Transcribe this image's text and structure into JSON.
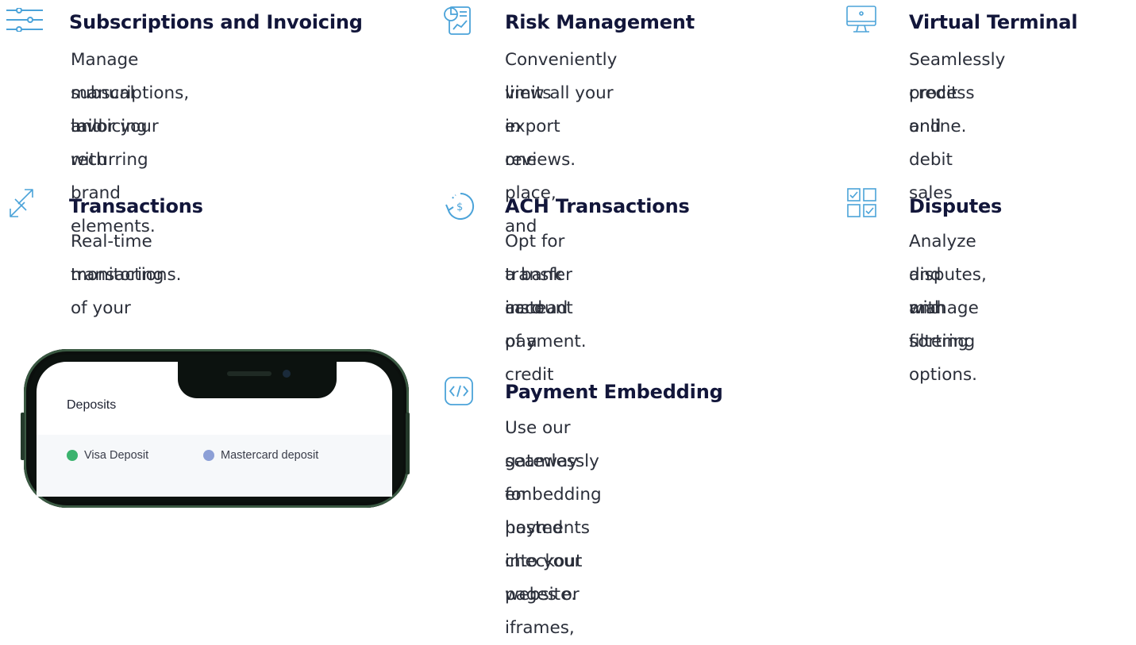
{
  "features": [
    {
      "icon": "sliders-icon",
      "title": "Subscriptions and Invoicing",
      "desc": [
        "Manage manual and recurring",
        "subscriptions, tailor your",
        "invoicing with brand elements."
      ]
    },
    {
      "icon": "report-chart-icon",
      "title": "Risk Management",
      "desc": [
        "Conveniently view all your",
        "limits in one place, and",
        "export reviews."
      ]
    },
    {
      "icon": "monitor-icon",
      "title": "Virtual Terminal",
      "desc": [
        "Seamlessly process",
        "credit and debit sales",
        "online."
      ]
    },
    {
      "icon": "transfer-arrows-icon",
      "title": "Transactions",
      "desc": [
        "Real-time monitoring of your",
        "transactions."
      ]
    },
    {
      "icon": "dollar-cycle-icon",
      "title": "ACH Transactions",
      "desc": [
        "Opt for a bank account",
        "transfer instead of a credit",
        "card payment."
      ]
    },
    {
      "icon": "checkbox-grid-icon",
      "title": "Disputes",
      "desc": [
        "Analyze and manage",
        "disputes, with sorting",
        "and filtering options."
      ]
    },
    {
      "icon": "code-embed-icon",
      "title": "Payment Embedding",
      "desc": [
        "Use our gateway for hosted checkout pages or iframes,",
        "seamlessly embedding payments into your website."
      ]
    }
  ],
  "phone": {
    "screen_title": "Deposits",
    "legend": [
      {
        "label": "Visa Deposit",
        "color": "#3bb36e"
      },
      {
        "label": "Mastercard deposit",
        "color": "#8c9fd6"
      }
    ]
  },
  "colors": {
    "title": "#12163a",
    "text": "#2b2f3a",
    "icon_accent": "#4ba3d9"
  }
}
